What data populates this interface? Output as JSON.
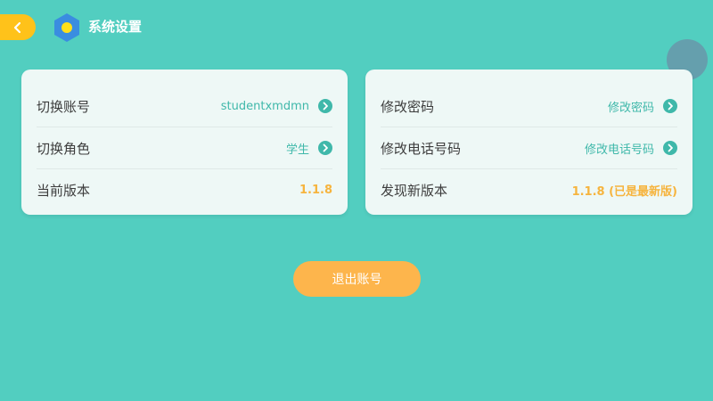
{
  "header": {
    "title": "系统设置",
    "back_icon": "chevron-left-icon",
    "settings_icon": "hexagon-settings-icon"
  },
  "colors": {
    "background": "#52cec0",
    "accent_teal": "#3fb8aa",
    "accent_orange": "#f6b43e",
    "back_button": "#ffc21a",
    "logout_button": "#fdb54c"
  },
  "left_card": {
    "rows": [
      {
        "label": "切换账号",
        "value": "studentxmdmn"
      },
      {
        "label": "切换角色",
        "value": "学生"
      },
      {
        "label": "当前版本",
        "value": "1.1.8"
      }
    ]
  },
  "right_card": {
    "rows": [
      {
        "label": "修改密码",
        "value": "修改密码"
      },
      {
        "label": "修改电话号码",
        "value": "修改电话号码"
      },
      {
        "label": "发现新版本",
        "value": "1.1.8 (已是最新版)"
      }
    ]
  },
  "logout": {
    "label": "退出账号"
  }
}
